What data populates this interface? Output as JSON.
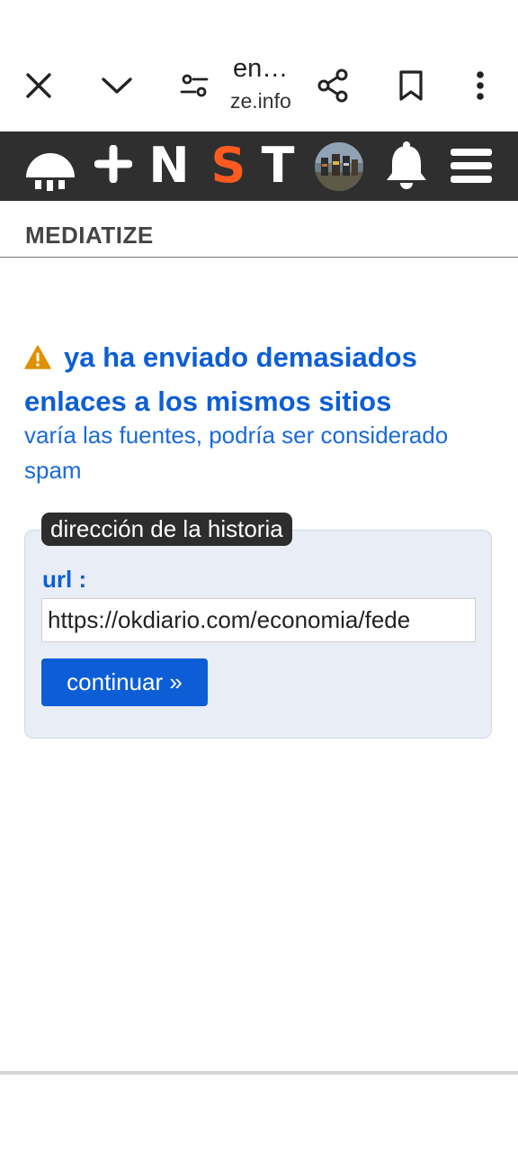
{
  "browser": {
    "title": "en…",
    "domain": "ze.info",
    "icons": [
      "close-icon",
      "chevron-down-icon",
      "tune-icon",
      "share-icon",
      "bookmark-icon",
      "more-vert-icon"
    ]
  },
  "sitebar": {
    "letters": [
      "N",
      "S",
      "T"
    ],
    "accent": "#ff5a1f",
    "icons": [
      "logo-icon",
      "plus-icon",
      "avatar",
      "bell-icon",
      "menu-icon"
    ]
  },
  "site_name": "MEDIATIZE",
  "warning": {
    "title": "ya ha enviado demasiados enlaces a los mismos sitios",
    "subtitle": "varía las fuentes, podría ser considerado spam",
    "icon": "warning-icon",
    "color": "#e09000"
  },
  "form": {
    "legend": "dirección de la historia",
    "url_label": "url :",
    "url_value": "https://okdiario.com/economia/fede",
    "submit_label": "continuar »"
  }
}
